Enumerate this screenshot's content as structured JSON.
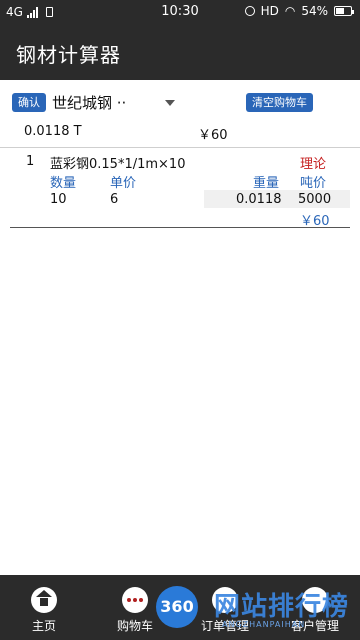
{
  "status_bar": {
    "network": "4G",
    "time": "10:30",
    "hd": "HD",
    "battery_percent": "54%",
    "battery_level": 0.54
  },
  "app_bar": {
    "title": "钢材计算器"
  },
  "toolbar": {
    "confirm_label": "确认",
    "supplier_selected": "世纪城钢 ··",
    "clear_cart_label": "清空购物车"
  },
  "summary": {
    "total_weight": "0.0118  T",
    "total_price": "￥60"
  },
  "cart_items": [
    {
      "index": "1",
      "name": "蓝彩钢0.15*1/1m×10",
      "mode": "理论",
      "headers": {
        "qty": "数量",
        "unit_price": "单价",
        "weight": "重量",
        "ton_price": "吨价"
      },
      "qty": "10",
      "unit_price": "6",
      "weight": "0.0118",
      "ton_price": "5000",
      "total": "￥60"
    }
  ],
  "bottom_nav": [
    {
      "label": "主页",
      "icon": "home-icon"
    },
    {
      "label": "购物车",
      "icon": "cart-icon"
    },
    {
      "label": "订单管理",
      "icon": "order-icon"
    },
    {
      "label": "客户管理",
      "icon": "customer-icon"
    }
  ],
  "watermark": {
    "badge": "360",
    "text": "网站排行榜",
    "sub": "ANGZHANPAIHAN"
  },
  "colors": {
    "bar_bg": "#2b2b2b",
    "accent_blue": "#2a66b8",
    "theory_red": "#c62020"
  }
}
